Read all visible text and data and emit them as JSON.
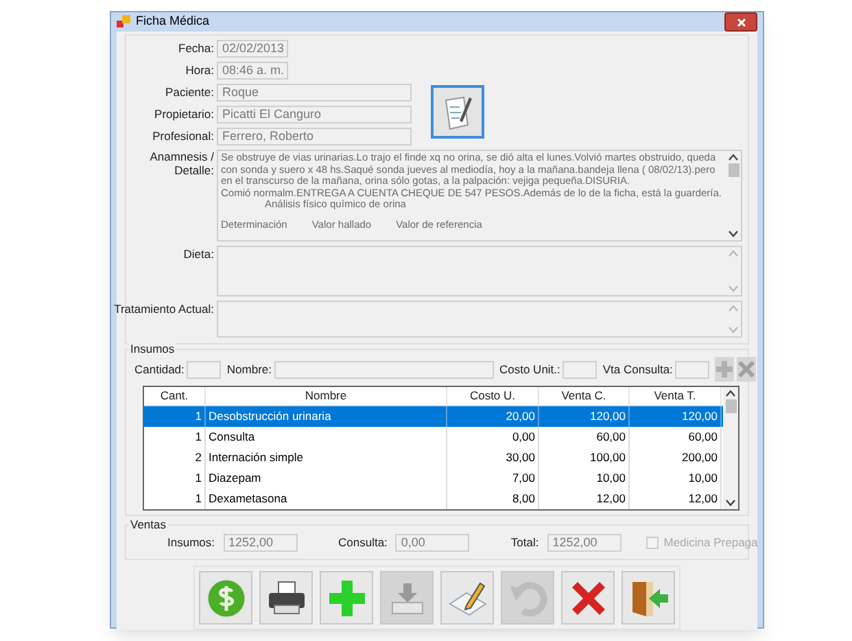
{
  "window": {
    "title": "Ficha Médica"
  },
  "fields": [
    {
      "label": "Fecha:",
      "value": "02/02/2013",
      "kind": "short"
    },
    {
      "label": "Hora:",
      "value": "08:46 a. m.",
      "kind": "short"
    },
    {
      "label": "Paciente:",
      "value": "Roque",
      "kind": "long"
    },
    {
      "label": "Propietario:",
      "value": "Picatti El Canguro",
      "kind": "long"
    },
    {
      "label": "Profesional:",
      "value": "Ferrero, Roberto",
      "kind": "long"
    }
  ],
  "anamnesis": {
    "label": "Anamnesis / Detalle:",
    "paragraphs": [
      "Se obstruye de vias urinarias.Lo trajo el finde xq no orina, se dió alta el lunes.Volvió martes obstruido, queda con sonda y suero x 48 hs.Saqué sonda jueves al mediodía, hoy a la mañana.bandeja llena ( 08/02/13).pero en el transcurso de la mañana, orina sólo gotas, a la palpación: vejiga pequeña.DISURIA.",
      "Comió normalm.ENTREGA A CUENTA CHEQUE DE 547 PESOS.Además de lo de la ficha, está la guardería."
    ],
    "subtitle": "Análisis físico químico de orina",
    "table_header": [
      "Determinación",
      "Valor hallado",
      "Valor de referencia"
    ]
  },
  "dieta": {
    "label": "Dieta:"
  },
  "tratamiento": {
    "label": "Tratamiento Actual:"
  },
  "insumos": {
    "title": "Insumos",
    "inputs": [
      {
        "label": "Cantidad:",
        "kind": "small"
      },
      {
        "label": "Nombre:",
        "kind": "wide"
      },
      {
        "label": "Costo Unit.:",
        "kind": "small"
      },
      {
        "label": "Vta Consulta:",
        "kind": "small"
      }
    ],
    "add_disabled": true,
    "delete_disabled": true,
    "columns": [
      "Cant.",
      "Nombre",
      "Costo U.",
      "Venta C.",
      "Venta T."
    ],
    "rows": [
      {
        "cells": [
          "1",
          "Desobstrucción urinaria",
          "20,00",
          "120,00",
          "120,00"
        ],
        "selected": true
      },
      {
        "cells": [
          "1",
          "Consulta",
          "0,00",
          "60,00",
          "60,00"
        ],
        "selected": false
      },
      {
        "cells": [
          "2",
          "Internación simple",
          "30,00",
          "100,00",
          "200,00"
        ],
        "selected": false
      },
      {
        "cells": [
          "1",
          "Diazepam",
          "7,00",
          "10,00",
          "10,00"
        ],
        "selected": false
      },
      {
        "cells": [
          "1",
          "Dexametasona",
          "8,00",
          "12,00",
          "12,00"
        ],
        "selected": false
      }
    ]
  },
  "ventas": {
    "title": "Ventas",
    "totals": [
      {
        "label": "Insumos:",
        "value": "1252,00"
      },
      {
        "label": "Consulta:",
        "value": "0,00"
      },
      {
        "label": "Total:",
        "value": "1252,00"
      }
    ],
    "prepaga": {
      "label": "Medicina Prepaga",
      "checked": false,
      "disabled": true
    }
  },
  "toolbar": [
    {
      "kind": "money",
      "disabled": false
    },
    {
      "kind": "print",
      "disabled": false
    },
    {
      "kind": "add",
      "disabled": false
    },
    {
      "kind": "save",
      "disabled": true
    },
    {
      "kind": "edit",
      "disabled": false
    },
    {
      "kind": "undo",
      "disabled": true
    },
    {
      "kind": "delete",
      "disabled": false
    },
    {
      "kind": "exit",
      "disabled": false
    }
  ]
}
